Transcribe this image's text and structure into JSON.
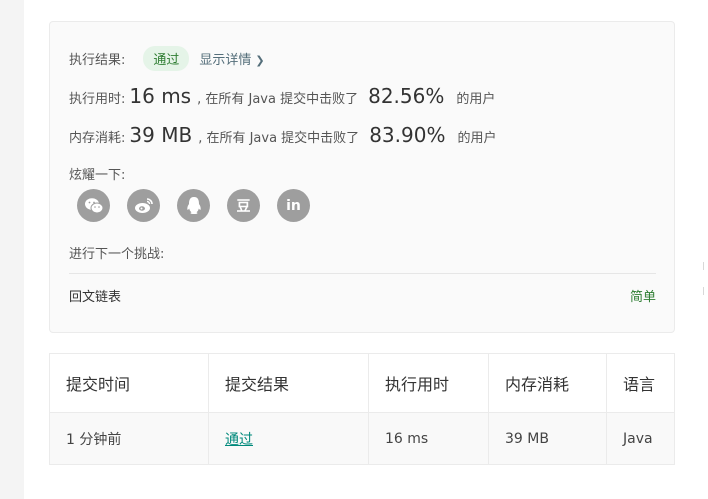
{
  "result": {
    "label": "执行结果:",
    "status": "通过",
    "detail_link": "显示详情",
    "status_color": "#2e7d32"
  },
  "runtime": {
    "label": "执行用时:",
    "value": "16 ms",
    "mid": ", 在所有 Java 提交中击败了",
    "percent": "82.56%",
    "suffix": "的用户"
  },
  "memory": {
    "label": "内存消耗:",
    "value": "39 MB",
    "mid": ", 在所有 Java 提交中击败了",
    "percent": "83.90%",
    "suffix": "的用户"
  },
  "share": {
    "label": "炫耀一下:",
    "icons": [
      "wechat-icon",
      "weibo-icon",
      "qq-icon",
      "douban-icon",
      "linkedin-icon"
    ],
    "douban_glyph": "豆",
    "linkedin_glyph": "in"
  },
  "next": {
    "label": "进行下一个挑战:",
    "problem": "回文链表",
    "difficulty": "简单",
    "difficulty_color": "#2e7d32"
  },
  "submissions": {
    "headers": [
      "提交时间",
      "提交结果",
      "执行用时",
      "内存消耗",
      "语言"
    ],
    "rows": [
      [
        "1 分钟前",
        "通过",
        "16 ms",
        "39 MB",
        "Java"
      ]
    ]
  }
}
